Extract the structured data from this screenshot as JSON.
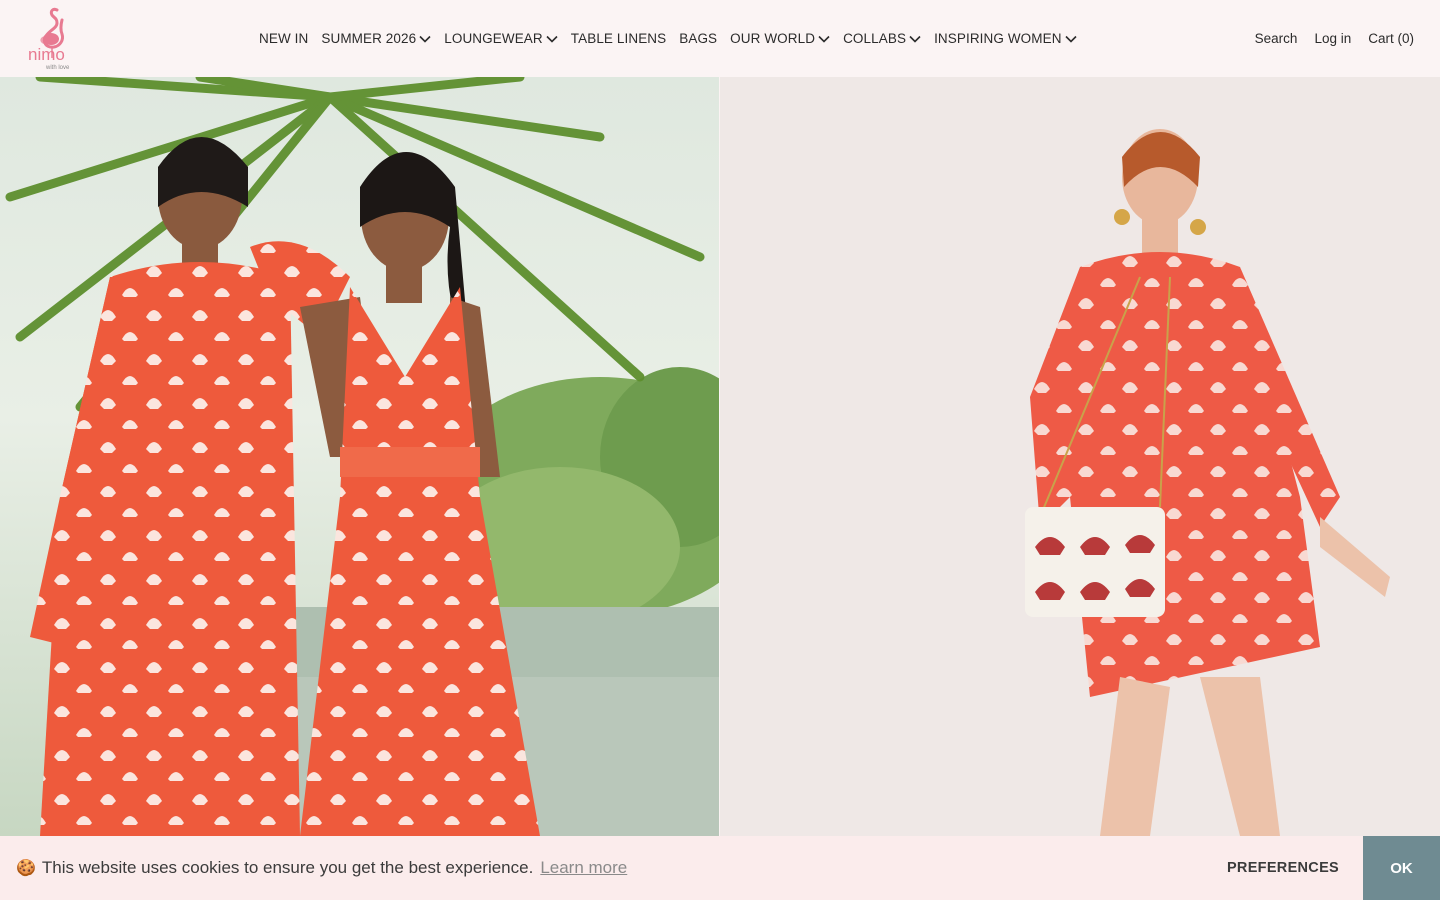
{
  "brand": {
    "logo_text": "nimo",
    "logo_tagline": "with love"
  },
  "nav": {
    "items": [
      {
        "label": "NEW IN",
        "dropdown": false
      },
      {
        "label": "SUMMER 2026",
        "dropdown": true
      },
      {
        "label": "LOUNGEWEAR",
        "dropdown": true
      },
      {
        "label": "TABLE LINENS",
        "dropdown": false
      },
      {
        "label": "BAGS",
        "dropdown": false
      },
      {
        "label": "OUR WORLD",
        "dropdown": true
      },
      {
        "label": "COLLABS",
        "dropdown": true
      },
      {
        "label": "INSPIRING WOMEN",
        "dropdown": true
      }
    ]
  },
  "utils": {
    "search": "Search",
    "login": "Log in",
    "cart": "Cart (0)"
  },
  "cookie": {
    "emoji": "🍪",
    "message": "This website uses cookies to ensure you get the best experience.",
    "learn_more": "Learn more",
    "preferences": "PREFERENCES",
    "ok": "OK"
  },
  "colors": {
    "accent_coral": "#ee5a3c",
    "ok_button": "#6f8b92",
    "logo_pink": "#e87a91"
  }
}
